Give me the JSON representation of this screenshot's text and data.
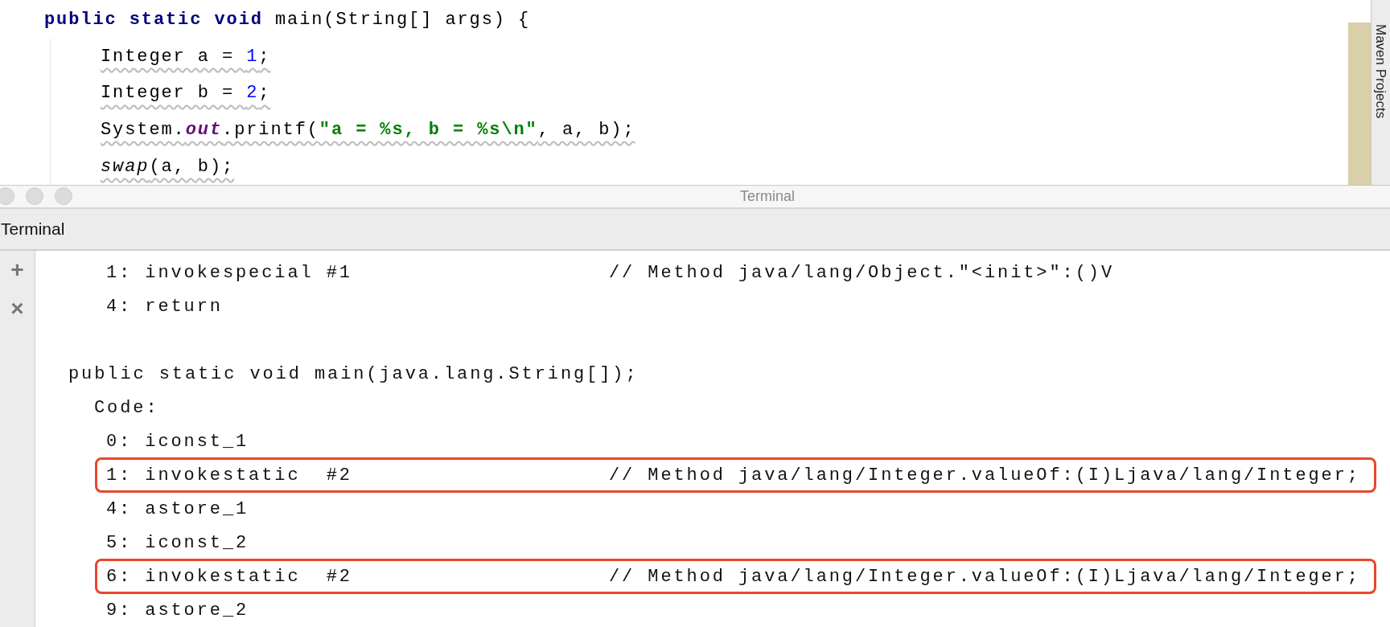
{
  "editor": {
    "lines": [
      {
        "indent": false,
        "warning": false,
        "tokens": [
          {
            "text": "public static void",
            "kind": "keyword"
          },
          {
            "text": " main(String[] args) {",
            "kind": "plain"
          }
        ]
      },
      {
        "indent": true,
        "warning": true,
        "tokens": [
          {
            "text": "Integer a = ",
            "kind": "plain"
          },
          {
            "text": "1",
            "kind": "number"
          },
          {
            "text": ";",
            "kind": "plain"
          }
        ]
      },
      {
        "indent": true,
        "warning": true,
        "tokens": [
          {
            "text": "Integer b = ",
            "kind": "plain"
          },
          {
            "text": "2",
            "kind": "number"
          },
          {
            "text": ";",
            "kind": "plain"
          }
        ]
      },
      {
        "indent": true,
        "warning": true,
        "tokens": [
          {
            "text": "System.",
            "kind": "plain"
          },
          {
            "text": "out",
            "kind": "field"
          },
          {
            "text": ".printf(",
            "kind": "plain"
          },
          {
            "text": "\"a = %s, b = %s\\n\"",
            "kind": "string"
          },
          {
            "text": ", a, b);",
            "kind": "plain"
          }
        ]
      },
      {
        "indent": true,
        "warning": true,
        "tokens": [
          {
            "text": "swap",
            "kind": "static"
          },
          {
            "text": "(a, b);",
            "kind": "plain"
          }
        ]
      }
    ]
  },
  "side_panel": {
    "label": "Maven Projects"
  },
  "window": {
    "title": "Terminal"
  },
  "tool_window": {
    "title": "Terminal",
    "actions": [
      "+",
      "×"
    ]
  },
  "terminal": {
    "lines": [
      {
        "kind": "instruction",
        "text": "1: invokespecial #1",
        "comment": "// Method java/lang/Object.\"<init>\":()V",
        "highlighted": false
      },
      {
        "kind": "instruction",
        "text": "4: return",
        "highlighted": false
      },
      {
        "kind": "blank"
      },
      {
        "kind": "method",
        "text": "public static void main(java.lang.String[]);"
      },
      {
        "kind": "label",
        "text": "Code:"
      },
      {
        "kind": "instruction",
        "text": "0: iconst_1",
        "highlighted": false
      },
      {
        "kind": "instruction",
        "text": "1: invokestatic  #2",
        "comment": "// Method java/lang/Integer.valueOf:(I)Ljava/lang/Integer;",
        "highlighted": true
      },
      {
        "kind": "instruction",
        "text": "4: astore_1",
        "highlighted": false
      },
      {
        "kind": "instruction",
        "text": "5: iconst_2",
        "highlighted": false
      },
      {
        "kind": "instruction",
        "text": "6: invokestatic  #2",
        "comment": "// Method java/lang/Integer.valueOf:(I)Ljava/lang/Integer;",
        "highlighted": true
      },
      {
        "kind": "instruction",
        "text": "9: astore_2",
        "highlighted": false
      }
    ]
  }
}
